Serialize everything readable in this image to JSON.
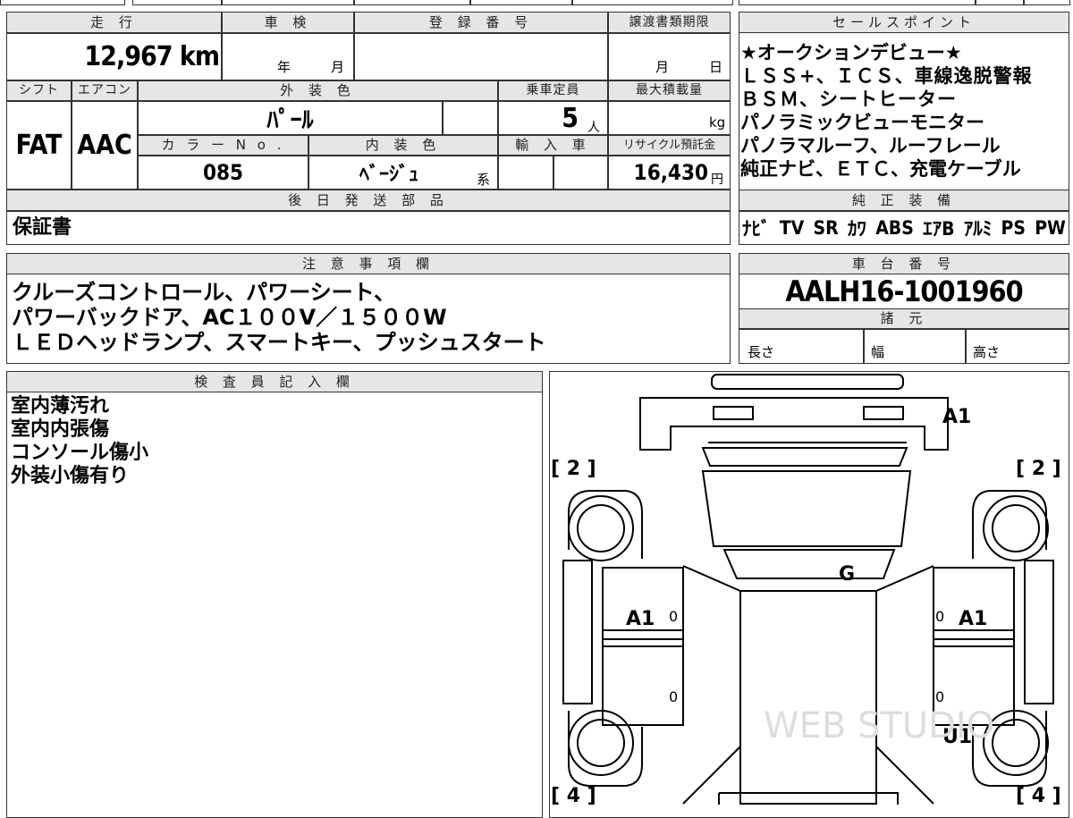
{
  "top_left": {
    "mileage_label": "走 行",
    "mileage_value": "12,967 km",
    "inspection_label": "車 検",
    "inspection_year": "年",
    "inspection_month": "月",
    "registration_label": "登 録 番 号",
    "transfer_label": "譲渡書類期限",
    "transfer_month": "月",
    "transfer_day": "日",
    "shift_label": "シフト",
    "aircon_label": "エアコン",
    "exterior_color_label": "外 装 色",
    "capacity_label": "乗車定員",
    "max_load_label": "最大積載量",
    "shift_value": "FAT",
    "aircon_value": "AAC",
    "exterior_color_value": "ﾊﾟｰﾙ",
    "capacity_value": "5",
    "capacity_unit": "人",
    "max_load_unit": "kg",
    "color_no_label": "カ ラ ー N o .",
    "interior_color_label": "内 装 色",
    "import_label": "輸 入 車",
    "recycle_label": "リサイクル預託金",
    "color_no_value": "085",
    "interior_color_value": "ﾍﾞｰｼﾞｭ",
    "interior_color_suffix": "系",
    "recycle_value": "16,430",
    "recycle_unit": "円",
    "later_parts_label": "後 日 発 送 部 品",
    "later_parts_value": "保証書"
  },
  "sales_points": {
    "label": "セールスポイント",
    "lines": [
      "★オークションデビュー★",
      "ＬＳＳ+、ＩＣＳ、車線逸脱警報",
      "ＢＳＭ、シートヒーター",
      "パノラミックビューモニター",
      "パノラマルーフ、ルーフレール",
      "純正ナビ、ＥＴＣ、充電ケーブル"
    ]
  },
  "equipment": {
    "label": "純 正 装 備",
    "items": [
      "ﾅﾋﾞ",
      "TV",
      "SR",
      "ｶﾜ",
      "ABS",
      "ｴｱB",
      "ｱﾙﾐ",
      "PS",
      "PW"
    ]
  },
  "notes": {
    "label": "注 意 事 項 欄",
    "lines": [
      "クルーズコントロール、パワーシート、",
      "パワーバックドア、AC１００V／１５００W",
      "ＬＥＤヘッドランプ、スマートキー、プッシュスタート"
    ]
  },
  "chassis": {
    "label": "車 台 番 号",
    "value": "AALH16-1001960",
    "specs_label": "諸 元",
    "length_label": "長さ",
    "width_label": "幅",
    "height_label": "高さ"
  },
  "inspector": {
    "label": "検 査 員 記 入 欄",
    "lines": [
      "室内薄汚れ",
      "室内内張傷",
      "コンソール傷小",
      "外装小傷有り"
    ]
  },
  "diagram": {
    "mark_front": "A1",
    "mark_glass": "G",
    "mark_left_door": "A1",
    "mark_right_door": "A1",
    "mark_right_rear": "U1",
    "zero": "0",
    "tl_bracket": "[ 2 ]",
    "tr_bracket": "[ 2 ]",
    "bl_bracket": "[ 4 ]",
    "br_bracket": "[ 4 ]",
    "watermark": "WEB STUDIO"
  }
}
